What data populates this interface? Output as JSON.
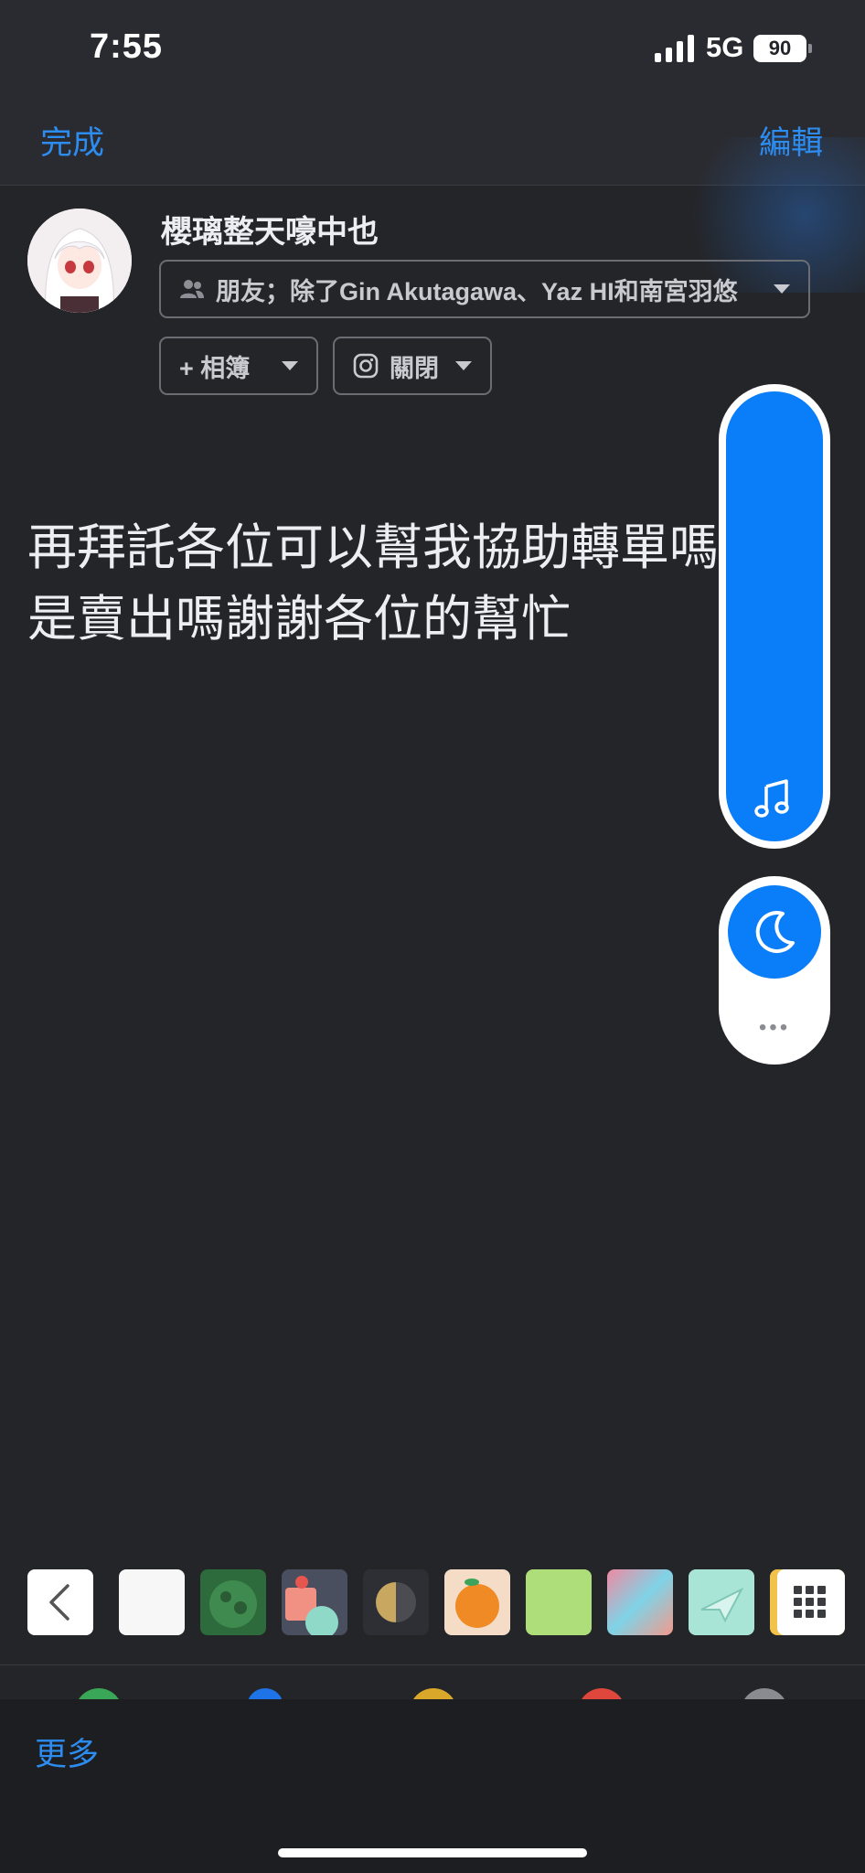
{
  "status_bar": {
    "time": "7:55",
    "network": "5G",
    "battery": "90"
  },
  "nav": {
    "done_label": "完成",
    "edit_label": "編輯"
  },
  "composer": {
    "author_name": "櫻璃整天嚎中也",
    "audience_label": "朋友；除了Gin Akutagawa、Yaz HI和南宮羽悠",
    "album_label": "+ 相簿",
    "instagram_label": "關閉",
    "post_text": "再拜託各位可以幫我協助轉單嗎\n是賣出嗎謝謝各位的幫忙"
  },
  "backgrounds": {
    "items": [
      {
        "name": "white",
        "color": "#f7f7f7"
      },
      {
        "name": "green-sphere",
        "color": "#2e6b3f"
      },
      {
        "name": "red-fruit",
        "color": "#4a4f5e"
      },
      {
        "name": "half-moon",
        "color": "#2e2f34"
      },
      {
        "name": "orange",
        "color": "#f4dcc7"
      },
      {
        "name": "lime",
        "color": "#aede7a"
      },
      {
        "name": "pink-blue-gradient",
        "color": "#e79aa9"
      },
      {
        "name": "paper-plane",
        "color": "#a9e5d7"
      },
      {
        "name": "grid",
        "color": "#f2c34a"
      }
    ]
  },
  "bottom": {
    "more_label": "更多"
  },
  "colors": {
    "accent": "#2d8cf0",
    "floating": "#0a7df8",
    "background": "#242529"
  }
}
